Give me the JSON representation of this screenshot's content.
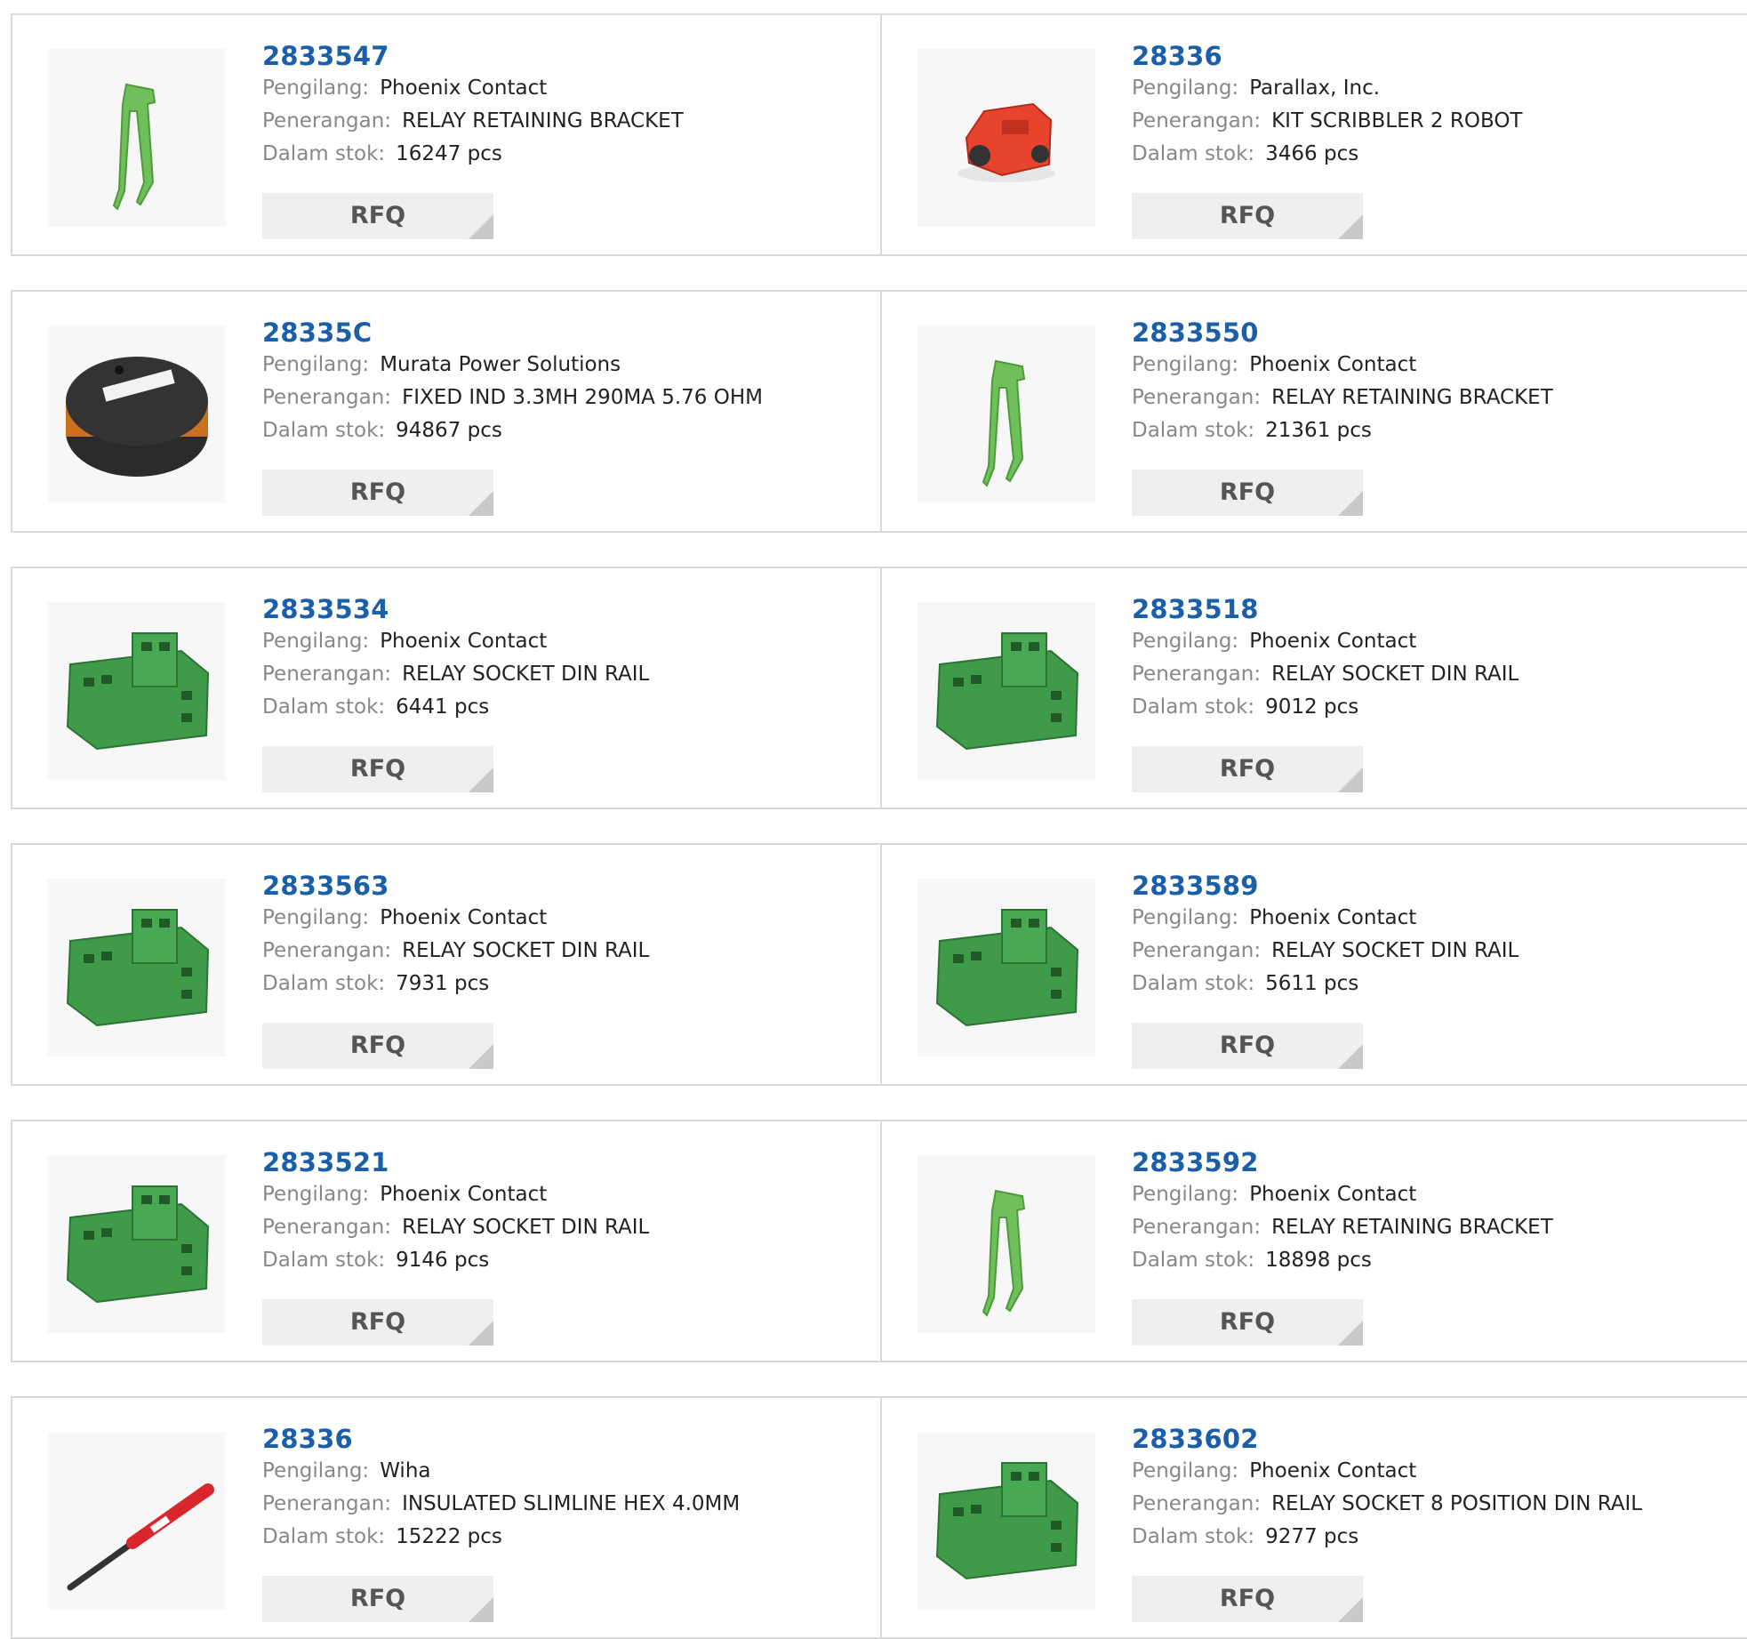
{
  "labels": {
    "manufacturer": "Pengilang:",
    "description": "Penerangan:",
    "stock": "Dalam stok:",
    "rfq": "RFQ"
  },
  "products": [
    {
      "part": "2833547",
      "manufacturer": "Phoenix Contact",
      "description": "RELAY RETAINING BRACKET",
      "stock": "16247 pcs",
      "image": "bracket-icon"
    },
    {
      "part": "28336",
      "manufacturer": "Parallax, Inc.",
      "description": "KIT SCRIBBLER 2 ROBOT",
      "stock": "3466 pcs",
      "image": "robot-icon"
    },
    {
      "part": "28335C",
      "manufacturer": "Murata Power Solutions",
      "description": "FIXED IND 3.3MH 290MA 5.76 OHM",
      "stock": "94867 pcs",
      "image": "inductor-icon"
    },
    {
      "part": "2833550",
      "manufacturer": "Phoenix Contact",
      "description": "RELAY RETAINING BRACKET",
      "stock": "21361 pcs",
      "image": "bracket-icon"
    },
    {
      "part": "2833534",
      "manufacturer": "Phoenix Contact",
      "description": "RELAY SOCKET DIN RAIL",
      "stock": "6441 pcs",
      "image": "relay-socket-icon"
    },
    {
      "part": "2833518",
      "manufacturer": "Phoenix Contact",
      "description": "RELAY SOCKET DIN RAIL",
      "stock": "9012 pcs",
      "image": "relay-socket-icon"
    },
    {
      "part": "2833563",
      "manufacturer": "Phoenix Contact",
      "description": "RELAY SOCKET DIN RAIL",
      "stock": "7931 pcs",
      "image": "relay-socket-icon"
    },
    {
      "part": "2833589",
      "manufacturer": "Phoenix Contact",
      "description": "RELAY SOCKET DIN RAIL",
      "stock": "5611 pcs",
      "image": "relay-socket-icon"
    },
    {
      "part": "2833521",
      "manufacturer": "Phoenix Contact",
      "description": "RELAY SOCKET DIN RAIL",
      "stock": "9146 pcs",
      "image": "relay-socket-icon"
    },
    {
      "part": "2833592",
      "manufacturer": "Phoenix Contact",
      "description": "RELAY RETAINING BRACKET",
      "stock": "18898 pcs",
      "image": "bracket-icon"
    },
    {
      "part": "28336",
      "manufacturer": "Wiha",
      "description": "INSULATED SLIMLINE HEX 4.0MM",
      "stock": "15222 pcs",
      "image": "screwdriver-icon"
    },
    {
      "part": "2833602",
      "manufacturer": "Phoenix Contact",
      "description": "RELAY SOCKET 8 POSITION DIN RAIL",
      "stock": "9277 pcs",
      "image": "relay-socket-icon"
    }
  ]
}
